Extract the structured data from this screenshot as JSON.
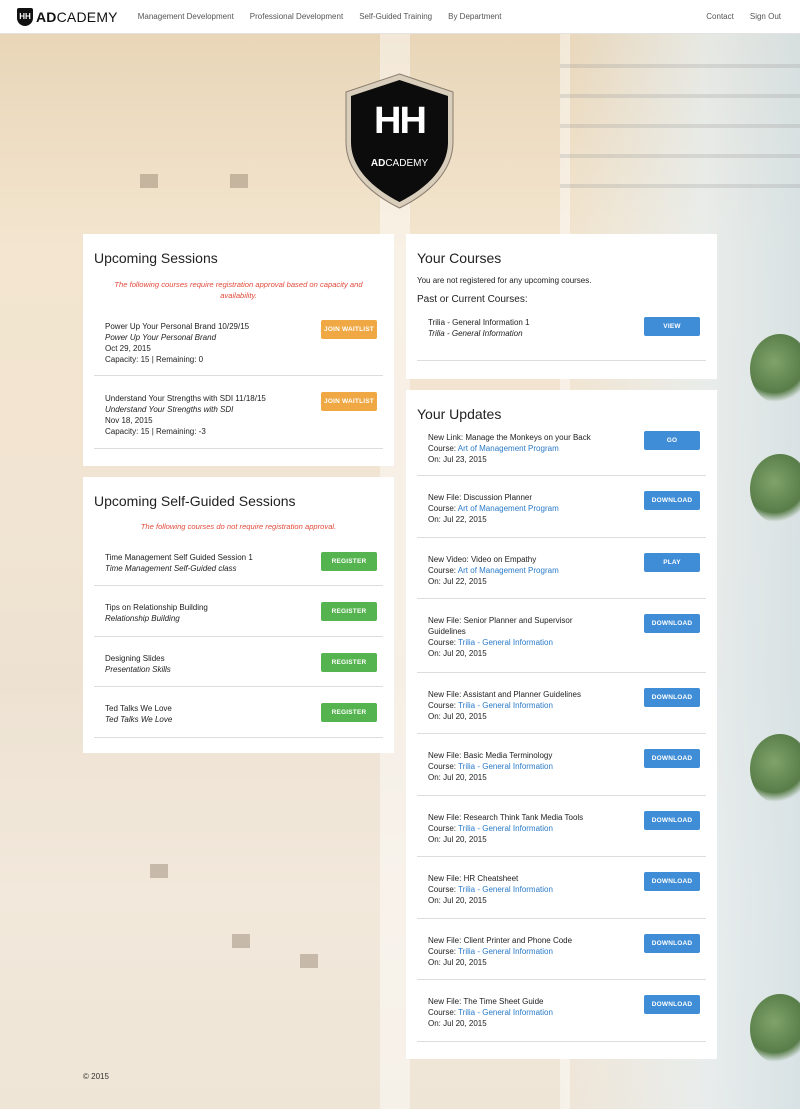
{
  "nav": {
    "brand_mark": "HH",
    "brand_bold": "AD",
    "brand_rest": "CADEMY",
    "links": [
      "Management Development",
      "Professional Development",
      "Self-Guided Training",
      "By Department"
    ],
    "right_links": [
      "Contact",
      "Sign Out"
    ]
  },
  "hero": {
    "logo_mark": "HH",
    "logo_bold": "AD",
    "logo_rest": "CADEMY"
  },
  "upcoming_sessions": {
    "title": "Upcoming Sessions",
    "notice": "The following courses require registration approval based on capacity and availability.",
    "items": [
      {
        "title": "Power Up Your Personal Brand 10/29/15",
        "subtitle": "Power Up Your Personal Brand",
        "date": "Oct 29, 2015",
        "capacity": "Capacity: 15 | Remaining: 0",
        "button": "JOIN WAITLIST"
      },
      {
        "title": "Understand Your Strengths with SDI 11/18/15",
        "subtitle": "Understand Your Strengths with SDI",
        "date": "Nov 18, 2015",
        "capacity": "Capacity: 15 | Remaining: -3",
        "button": "JOIN WAITLIST"
      }
    ]
  },
  "self_guided": {
    "title": "Upcoming Self-Guided Sessions",
    "notice": "The following courses do not require registration approval.",
    "items": [
      {
        "title": "Time Management Self Guided Session 1",
        "subtitle": "Time Management Self-Guided class",
        "button": "REGISTER"
      },
      {
        "title": "Tips on Relationship Building",
        "subtitle": "Relationship Building",
        "button": "REGISTER"
      },
      {
        "title": "Designing Slides",
        "subtitle": "Presentation Skills",
        "button": "REGISTER"
      },
      {
        "title": "Ted Talks We Love",
        "subtitle": "Ted Talks We Love",
        "button": "REGISTER"
      }
    ]
  },
  "your_courses": {
    "title": "Your Courses",
    "not_registered": "You are not registered for any upcoming courses.",
    "past_heading": "Past or Current Courses:",
    "items": [
      {
        "title": "Trilia - General Information 1",
        "subtitle": "Trilia - General Information",
        "button": "VIEW"
      }
    ]
  },
  "your_updates": {
    "title": "Your Updates",
    "course_label": "Course: ",
    "items": [
      {
        "title": "New Link: Manage the Monkeys on your Back",
        "course": "Art of Management Program",
        "date": "On: Jul 23, 2015",
        "button": "GO"
      },
      {
        "title": "New File: Discussion Planner",
        "course": "Art of Management Program",
        "date": "On: Jul 22, 2015",
        "button": "DOWNLOAD"
      },
      {
        "title": "New Video: Video on Empathy",
        "course": "Art of Management Program",
        "date": "On: Jul 22, 2015",
        "button": "PLAY"
      },
      {
        "title": "New File: Senior Planner and Supervisor Guidelines",
        "course": "Trilia - General Information",
        "date": "On: Jul 20, 2015",
        "button": "DOWNLOAD"
      },
      {
        "title": "New File: Assistant and Planner Guidelines",
        "course": "Trilia - General Information",
        "date": "On: Jul 20, 2015",
        "button": "DOWNLOAD"
      },
      {
        "title": "New File: Basic Media Terminology",
        "course": "Trilia - General Information",
        "date": "On: Jul 20, 2015",
        "button": "DOWNLOAD"
      },
      {
        "title": "New File: Research Think Tank Media Tools",
        "course": "Trilia - General Information",
        "date": "On: Jul 20, 2015",
        "button": "DOWNLOAD"
      },
      {
        "title": "New File: HR Cheatsheet",
        "course": "Trilia - General Information",
        "date": "On: Jul 20, 2015",
        "button": "DOWNLOAD"
      },
      {
        "title": "New File: Client Printer and Phone Code",
        "course": "Trilia - General Information",
        "date": "On: Jul 20, 2015",
        "button": "DOWNLOAD"
      },
      {
        "title": "New File: The Time Sheet Guide",
        "course": "Trilia - General Information",
        "date": "On: Jul 20, 2015",
        "button": "DOWNLOAD"
      }
    ]
  },
  "footer": {
    "copyright": "© 2015"
  },
  "colors": {
    "link": "#2a7ac8",
    "warning": "#e24a3b",
    "waitlist": "#efa843",
    "register": "#55b44f",
    "action": "#3f8dd6"
  },
  "icons": {
    "brand": "shield-logo-icon"
  }
}
